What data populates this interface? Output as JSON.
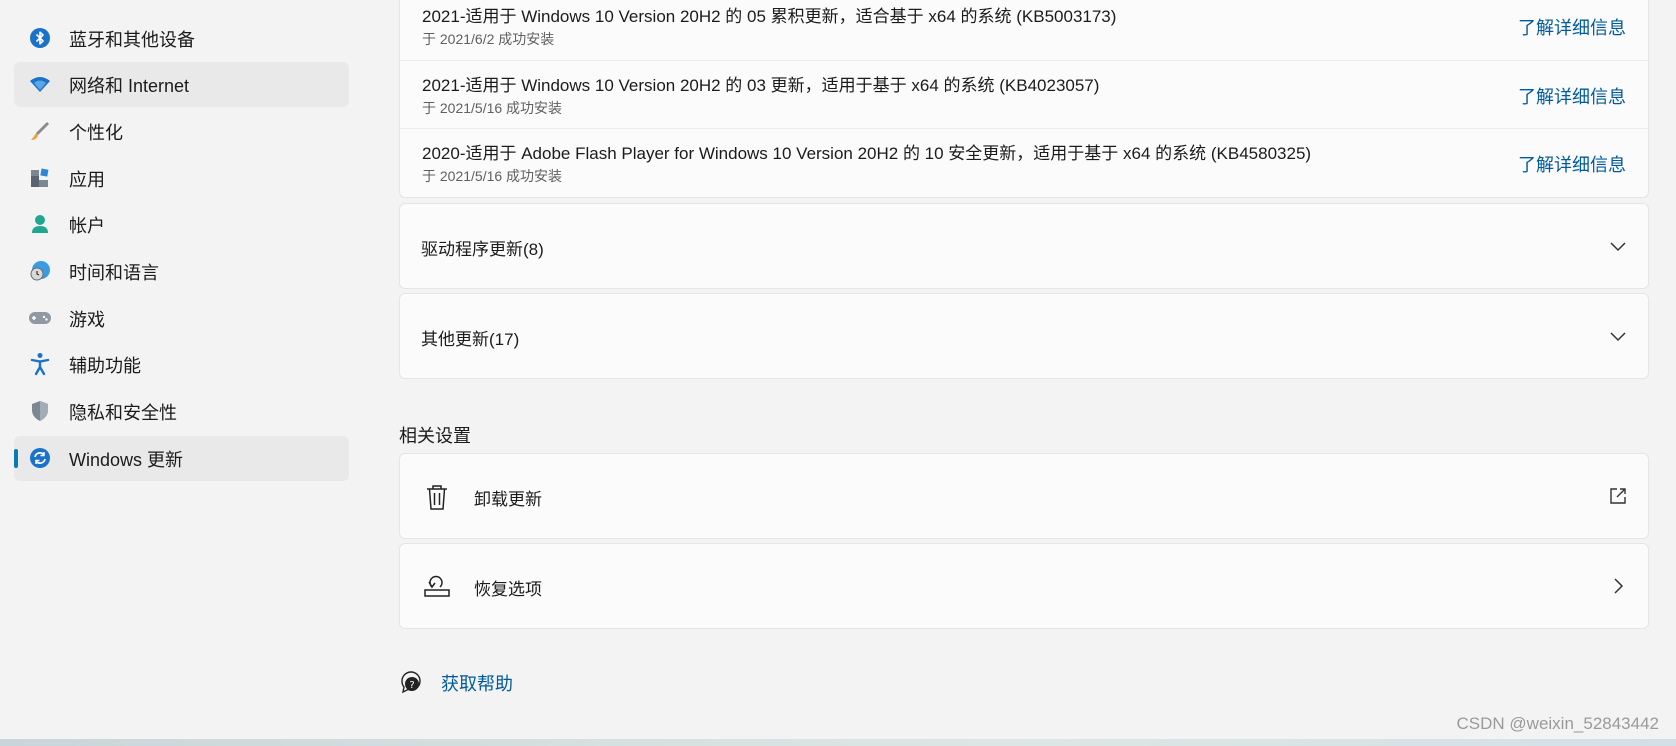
{
  "sidebar": {
    "items": [
      {
        "label": "蓝牙和其他设备",
        "icon": "bluetooth-icon"
      },
      {
        "label": "网络和 Internet",
        "icon": "wifi-icon"
      },
      {
        "label": "个性化",
        "icon": "brush-icon"
      },
      {
        "label": "应用",
        "icon": "apps-icon"
      },
      {
        "label": "帐户",
        "icon": "account-icon"
      },
      {
        "label": "时间和语言",
        "icon": "globe-clock-icon"
      },
      {
        "label": "游戏",
        "icon": "gamepad-icon"
      },
      {
        "label": "辅助功能",
        "icon": "accessibility-icon"
      },
      {
        "label": "隐私和安全性",
        "icon": "shield-icon"
      },
      {
        "label": "Windows 更新",
        "icon": "windows-update-icon"
      }
    ]
  },
  "updates": [
    {
      "title": "2021-适用于 Windows 10 Version 20H2 的 05 累积更新，适合基于 x64 的系统 (KB5003173)",
      "subtitle": "于 2021/6/2 成功安装",
      "link": "了解详细信息"
    },
    {
      "title": "2021-适用于 Windows 10 Version 20H2 的 03 更新，适用于基于 x64 的系统 (KB4023057)",
      "subtitle": "于 2021/5/16 成功安装",
      "link": "了解详细信息"
    },
    {
      "title": "2020-适用于 Adobe Flash Player for Windows 10 Version 20H2 的 10 安全更新，适用于基于 x64 的系统 (KB4580325)",
      "subtitle": "于 2021/5/16 成功安装",
      "link": "了解详细信息"
    }
  ],
  "groups": {
    "driver": "驱动程序更新(8)",
    "other": "其他更新(17)"
  },
  "related": {
    "heading": "相关设置",
    "uninstall": "卸载更新",
    "recovery": "恢复选项"
  },
  "help": {
    "label": "获取帮助"
  },
  "watermark": "CSDN @weixin_52843442",
  "colors": {
    "accent": "#0a7cb5",
    "link": "#005a9e"
  }
}
